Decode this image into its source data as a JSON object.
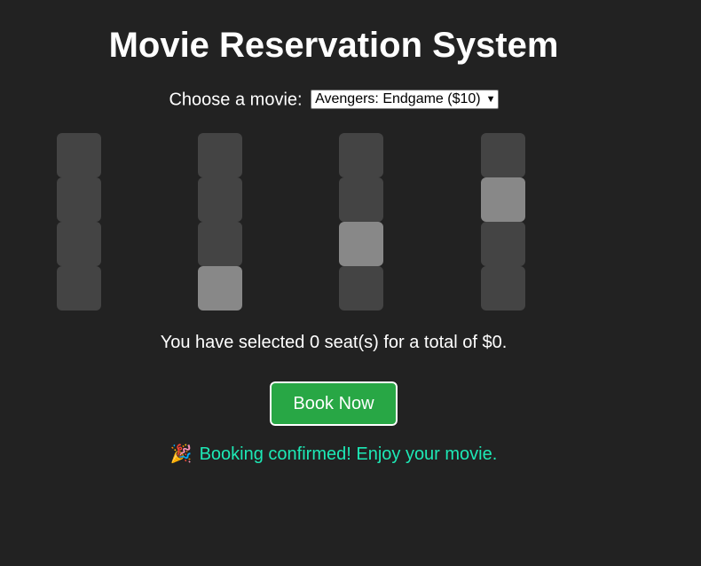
{
  "title": "Movie Reservation System",
  "movie_label": "Choose a movie:",
  "movie_select": {
    "selected": "Avengers: Endgame ($10)",
    "icon": "chevron-down-icon"
  },
  "seat_columns": [
    {
      "seats": [
        "available",
        "available",
        "available",
        "available"
      ]
    },
    {
      "seats": [
        "available",
        "available",
        "available",
        "occupied"
      ]
    },
    {
      "seats": [
        "available",
        "available",
        "occupied",
        "available"
      ]
    },
    {
      "seats": [
        "available",
        "occupied",
        "available",
        "available"
      ]
    }
  ],
  "summary": {
    "prefix": "You have selected ",
    "count": "0",
    "middle": " seat(s) for a total of $",
    "total": "0",
    "suffix": "."
  },
  "book_button_label": "Book Now",
  "confirmation": {
    "icon": "party-popper-icon",
    "emoji": "🎉",
    "text": "Booking confirmed! Enjoy your movie."
  },
  "colors": {
    "background": "#222222",
    "seat_available": "#444444",
    "seat_occupied": "#888888",
    "book_button": "#28a745",
    "confirmation_text": "#1de9b6"
  }
}
